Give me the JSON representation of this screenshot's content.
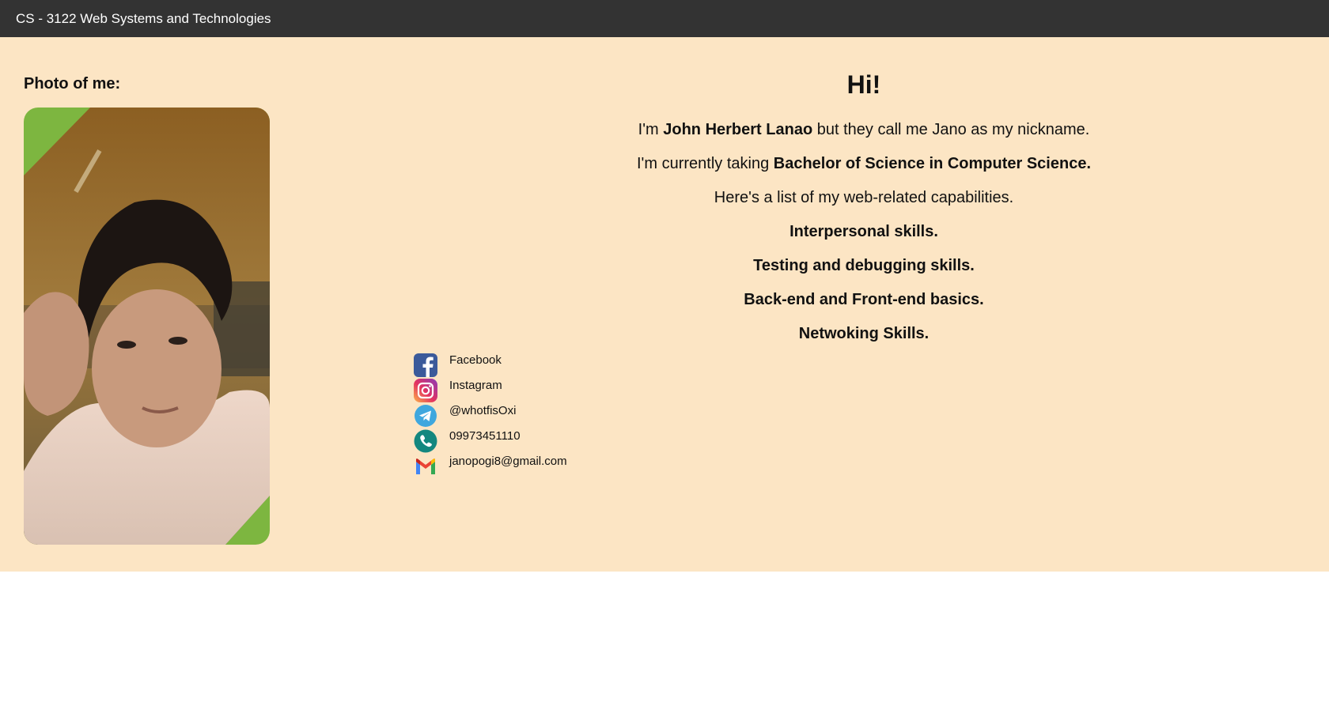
{
  "header": {
    "title": "CS - 3122 Web Systems and Technologies"
  },
  "photo": {
    "label": "Photo of me:"
  },
  "intro": {
    "greeting": "Hi!",
    "line1_prefix": "I'm ",
    "line1_name": "John Herbert Lanao",
    "line1_suffix": " but they call me Jano as my nickname.",
    "line2_prefix": "I'm currently taking ",
    "line2_course": "Bachelor of Science in Computer Science.",
    "line3": "Here's a list of my web-related capabilities.",
    "skills": [
      "Interpersonal skills.",
      "Testing and debugging skills.",
      "Back-end and Front-end basics.",
      "Netwoking Skills."
    ]
  },
  "contacts": [
    {
      "icon": "facebook-icon",
      "text": "Facebook"
    },
    {
      "icon": "instagram-icon",
      "text": "Instagram"
    },
    {
      "icon": "telegram-icon",
      "text": "@whotfisOxi"
    },
    {
      "icon": "phone-icon",
      "text": "09973451110"
    },
    {
      "icon": "gmail-icon",
      "text": "janopogi8@gmail.com"
    }
  ],
  "colors": {
    "topbar": "#333333",
    "background": "#fce5c4",
    "photo_accent": "#7db640"
  }
}
